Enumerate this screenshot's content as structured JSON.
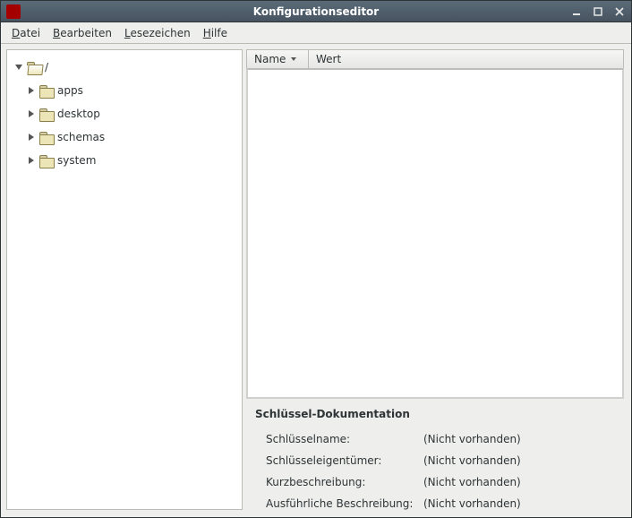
{
  "window": {
    "title": "Konfigurationseditor"
  },
  "menu": {
    "datei": "Datei",
    "bearbeiten": "Bearbeiten",
    "lesezeichen": "Lesezeichen",
    "hilfe": "Hilfe"
  },
  "tree": {
    "root": "/",
    "items": [
      {
        "label": "apps"
      },
      {
        "label": "desktop"
      },
      {
        "label": "schemas"
      },
      {
        "label": "system"
      }
    ]
  },
  "columns": {
    "name": "Name",
    "wert": "Wert"
  },
  "doc": {
    "heading": "Schlüssel-Dokumentation",
    "rows": [
      {
        "label": "Schlüsselname:",
        "value": "(Nicht vorhanden)"
      },
      {
        "label": "Schlüsseleigentümer:",
        "value": "(Nicht vorhanden)"
      },
      {
        "label": "Kurzbeschreibung:",
        "value": "(Nicht vorhanden)"
      },
      {
        "label": "Ausführliche Beschreibung:",
        "value": "(Nicht vorhanden)"
      }
    ]
  }
}
